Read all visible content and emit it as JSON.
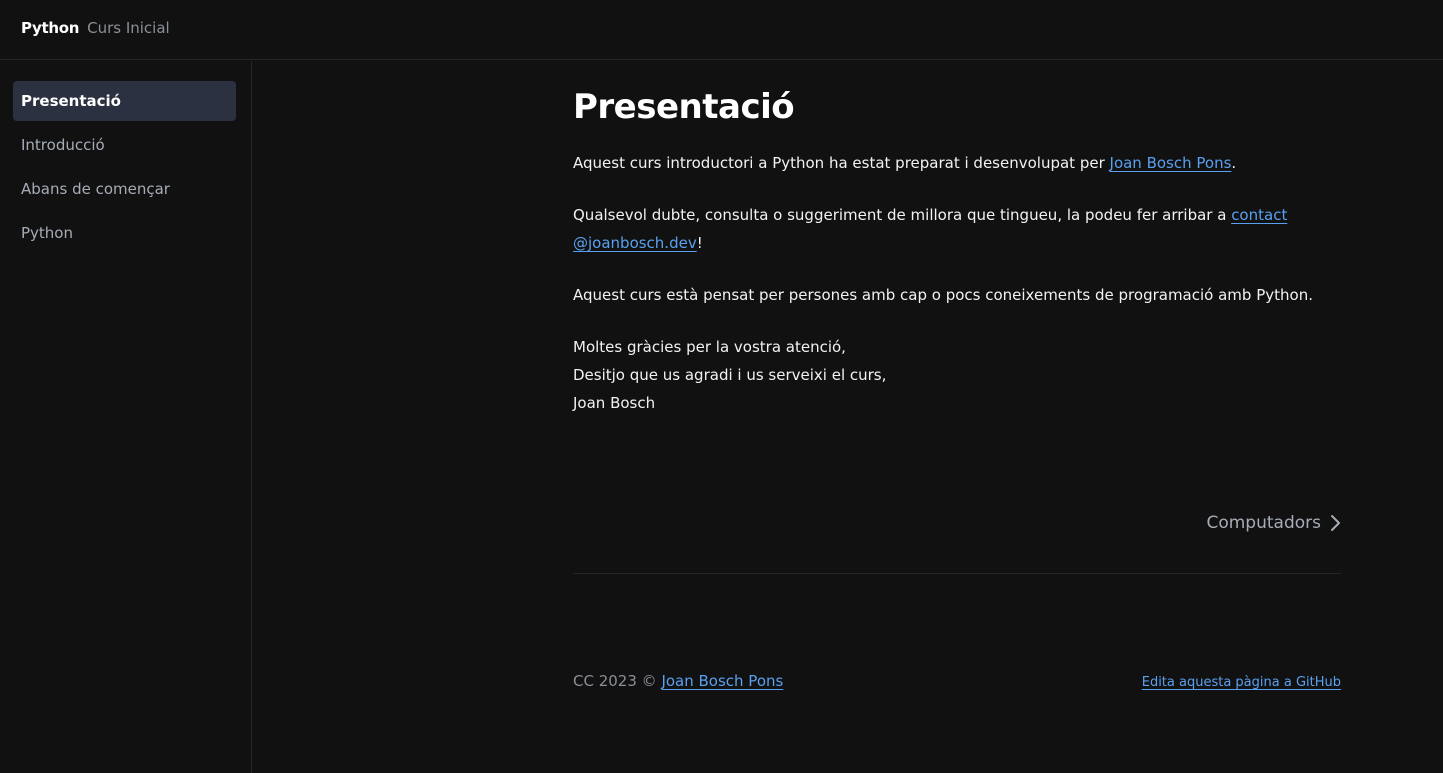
{
  "header": {
    "title": "Python",
    "subtitle": "Curs Inicial"
  },
  "sidebar": {
    "items": [
      {
        "label": "Presentació",
        "active": true
      },
      {
        "label": "Introducció",
        "active": false
      },
      {
        "label": "Abans de començar",
        "active": false
      },
      {
        "label": "Python",
        "active": false
      }
    ]
  },
  "main": {
    "title": "Presentació",
    "p1": {
      "text": "Aquest curs introductori a Python ha estat preparat i desenvolupat per ",
      "link": "Joan Bosch Pons",
      "after": "."
    },
    "p2": {
      "text": "Qualsevol dubte, consulta o suggeriment de millora que tingueu, la podeu fer arribar a ",
      "link_line1": "contact",
      "link_line2": "@joanbosch.dev",
      "after": "!"
    },
    "p3": "Aquest curs està pensat per persones amb cap o pocs coneixements de programació amb Python.",
    "p4": {
      "line1": "Moltes gràcies per la vostra atenció,",
      "line2": "Desitjo que us agradi i us serveixi el curs,",
      "line3": "Joan Bosch"
    },
    "next_label": "Computadors"
  },
  "footer": {
    "copyright": "CC 2023 © ",
    "author_link": "Joan Bosch Pons",
    "edit_link": "Edita aquesta pàgina a GitHub"
  },
  "colors": {
    "background": "#111111",
    "accent": "#5aa0f0",
    "active_nav": "#2b3140"
  }
}
